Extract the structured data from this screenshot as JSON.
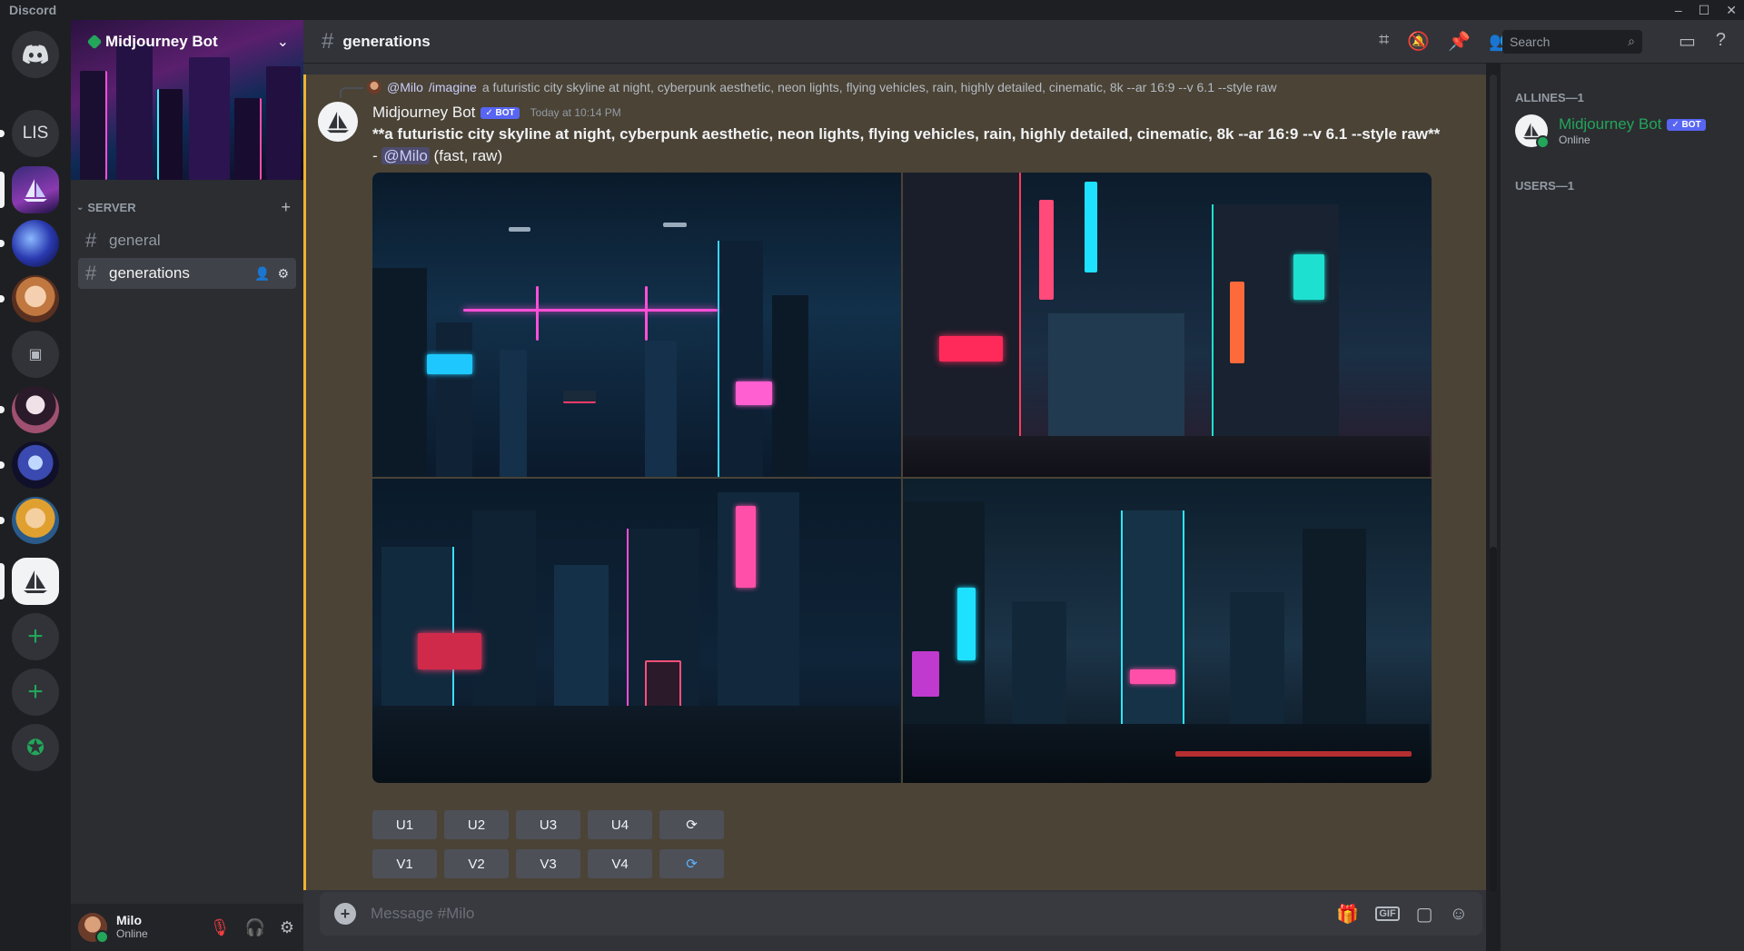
{
  "window": {
    "title": "Discord",
    "controls": [
      "–",
      "☐",
      "✕"
    ]
  },
  "server": {
    "name": "Midjourney Bot",
    "category": "SERVER"
  },
  "server_rail": {
    "text_server": "LIS"
  },
  "channels": [
    {
      "name": "general"
    },
    {
      "name": "generations"
    }
  ],
  "current_channel": "generations",
  "search": {
    "placeholder": "Search"
  },
  "message": {
    "reply": {
      "mention": "@Milo",
      "command": "/imagine",
      "prompt": "a futuristic city skyline at night, cyberpunk aesthetic, neon lights, flying vehicles, rain, highly detailed, cinematic, 8k --ar 16:9 --v 6.1 --style raw"
    },
    "author": "Midjourney Bot",
    "bot_tag": "✓ BOT",
    "timestamp": "Today at 10:14 PM",
    "body_bold": "**a futuristic city skyline at night, cyberpunk aesthetic, neon lights, flying vehicles, rain, highly detailed, cinematic, 8k --ar 16:9 --v 6.1 --style raw**",
    "body_sep": " - ",
    "body_mention": "@Milo",
    "body_suffix": " (fast, raw)"
  },
  "buttons": {
    "row1": [
      "U1",
      "U2",
      "U3",
      "U4",
      "⟳"
    ],
    "row2": [
      "V1",
      "V2",
      "V3",
      "V4",
      "⟳"
    ]
  },
  "composer": {
    "placeholder": "Message #Milo"
  },
  "user": {
    "name": "Milo",
    "status": "Online"
  },
  "members": {
    "section1": "ALLINES—1",
    "section2": "USERS—1",
    "bot": {
      "name": "Midjourney Bot",
      "tag": "✓ BOT",
      "status": "Online"
    }
  },
  "colors": {
    "accent": "#5865f2",
    "online": "#23a55a",
    "highlight": "#4a4336",
    "highlight_bar": "#f0b232"
  }
}
